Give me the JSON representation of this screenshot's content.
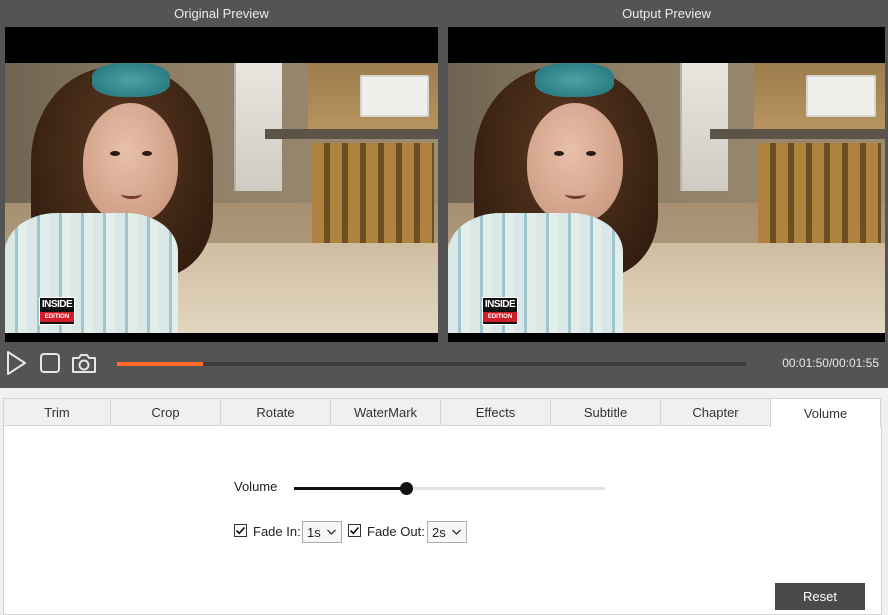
{
  "preview": {
    "original_title": "Original Preview",
    "output_title": "Output Preview",
    "watermark_top": "INSIDE",
    "watermark_bottom": "EDITION"
  },
  "controls": {
    "time": "00:01:50/00:01:55",
    "progress_fraction": 0.137,
    "accent_color": "#ff6a2b"
  },
  "tabs": [
    {
      "label": "Trim"
    },
    {
      "label": "Crop"
    },
    {
      "label": "Rotate"
    },
    {
      "label": "WaterMark"
    },
    {
      "label": "Effects"
    },
    {
      "label": "Subtitle"
    },
    {
      "label": "Chapter"
    },
    {
      "label": "Volume",
      "active": true
    }
  ],
  "volume_panel": {
    "volume_label": "Volume",
    "volume_fraction": 0.36,
    "fade_in": {
      "label": "Fade In:",
      "checked": true,
      "value": "1s"
    },
    "fade_out": {
      "label": "Fade Out:",
      "checked": true,
      "value": "2s"
    },
    "reset_label": "Reset"
  }
}
